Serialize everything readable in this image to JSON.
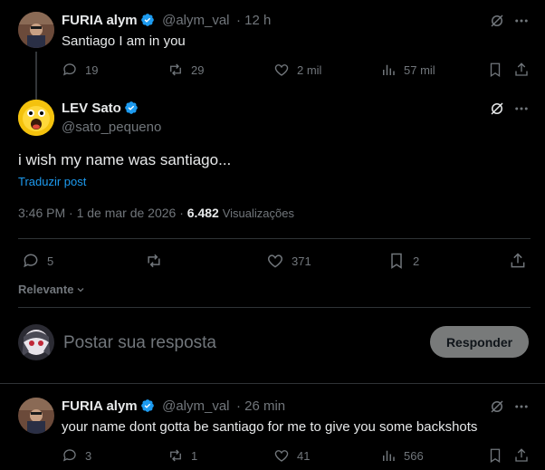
{
  "post1": {
    "name": "FURIA alym",
    "handle": "@alym_val",
    "time": "· 12 h",
    "text": "Santiago I am in you",
    "replies": "19",
    "reposts": "29",
    "likes": "2 mil",
    "views": "57 mil"
  },
  "main": {
    "name": "LEV Sato",
    "handle": "@sato_pequeno",
    "text": "i wish my name was santiago...",
    "translate": "Traduzir post",
    "timestamp": "3:46 PM · 1 de mar de 2026 · ",
    "views_count": "6.482",
    "views_label": "Visualizações",
    "replies": "5",
    "likes": "371",
    "bookmarks": "2"
  },
  "sort": {
    "label": "Relevante"
  },
  "compose": {
    "placeholder": "Postar sua resposta",
    "button": "Responder"
  },
  "reply": {
    "name": "FURIA alym",
    "handle": "@alym_val",
    "time": "· 26 min",
    "text": "your name dont gotta be santiago for me to give you some backshots",
    "replies": "3",
    "reposts": "1",
    "likes": "41",
    "views": "566"
  },
  "colors": {
    "accent": "#1d9bf0",
    "muted": "#71767b",
    "bg": "#000000",
    "button_bg": "#787a7a"
  }
}
